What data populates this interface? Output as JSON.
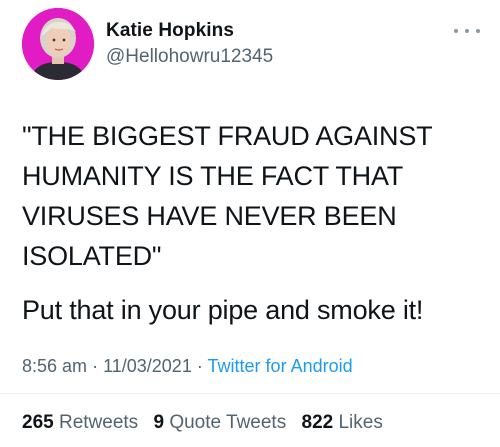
{
  "author": {
    "name": "Katie Hopkins",
    "handle": "@Hellohowru12345",
    "avatar_bg": "#e21cc4"
  },
  "tweet": {
    "quote_lines": [
      "\"THE BIGGEST FRAUD AGAINST",
      "HUMANITY IS THE FACT THAT",
      "VIRUSES HAVE NEVER BEEN",
      "ISOLATED\""
    ],
    "punchline": "Put that in your pipe and smoke it!"
  },
  "meta": {
    "time": "8:56 am",
    "separator": "·",
    "date": "11/03/2021",
    "source": "Twitter for Android",
    "source_color": "#1d9bf0"
  },
  "stats": {
    "retweets_count": "265",
    "retweets_label": "Retweets",
    "quotes_count": "9",
    "quotes_label": "Quote Tweets",
    "likes_count": "822",
    "likes_label": "Likes"
  },
  "icons": {
    "more": "more-options-icon"
  }
}
